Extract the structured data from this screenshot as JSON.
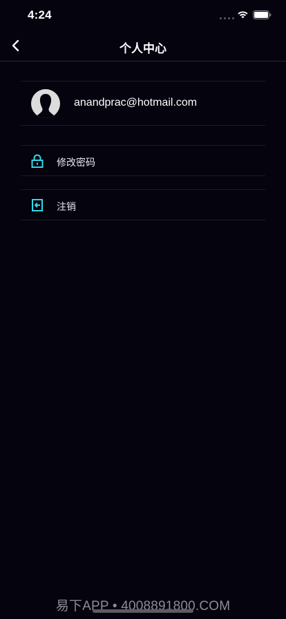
{
  "status_bar": {
    "time": "4:24"
  },
  "nav": {
    "title": "个人中心",
    "back_icon": "chevron-left-icon"
  },
  "profile": {
    "email": "anandprac@hotmail.com",
    "avatar_icon": "avatar-silhouette-icon"
  },
  "menu": [
    {
      "label": "修改密码",
      "icon": "lock-icon"
    },
    {
      "label": "注销",
      "icon": "logout-icon"
    }
  ],
  "watermark": "易下APP • 4008891800.COM",
  "colors": {
    "background": "#04030e",
    "accent": "#35d7e7",
    "divider": "#1b1d26",
    "text": "#ffffff"
  }
}
